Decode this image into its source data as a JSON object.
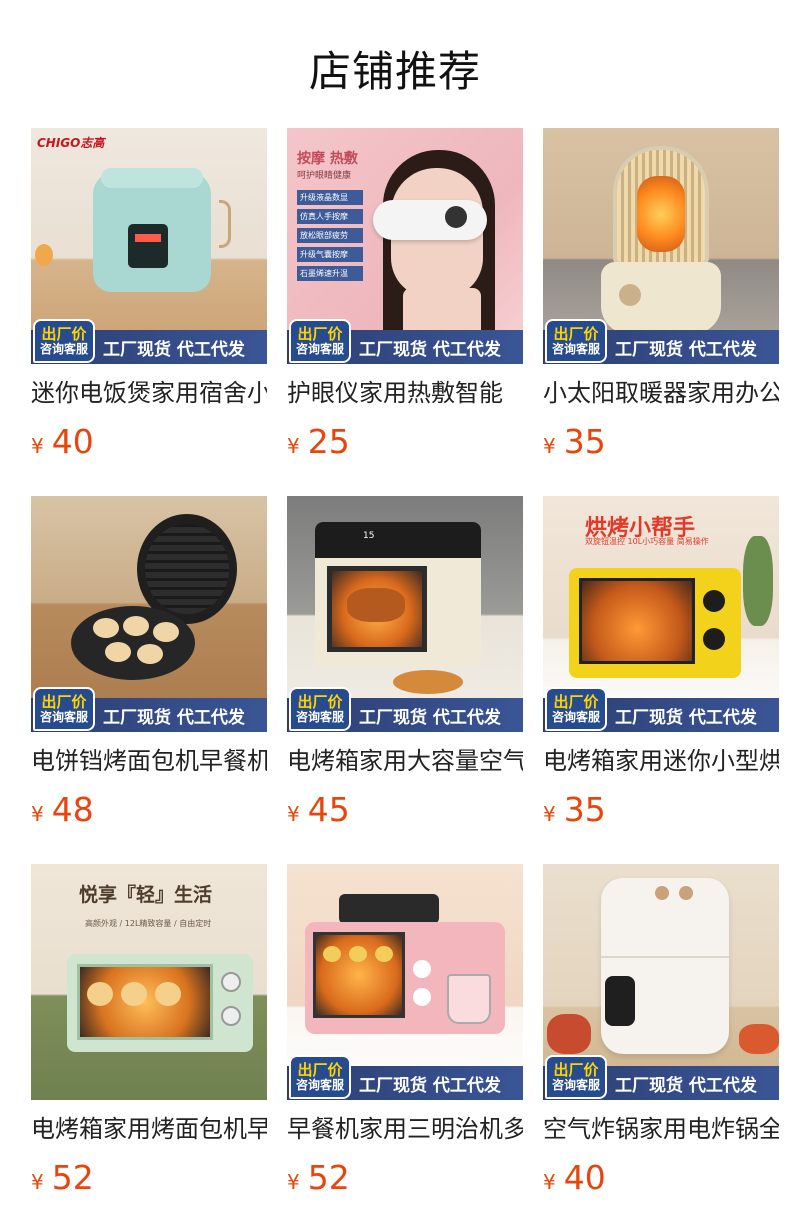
{
  "page": {
    "title": "店铺推荐"
  },
  "badge": {
    "line1": "出厂价",
    "line2": "咨询客服",
    "promo": "工厂现货 代工代发"
  },
  "products": [
    {
      "name": "迷你电饭煲家用宿舍小型",
      "currency": "¥",
      "price": "40",
      "image_text": {
        "brand": "CHIGO志高"
      }
    },
    {
      "name": "护眼仪家用热敷智能",
      "currency": "¥",
      "price": "25",
      "image_text": {
        "title": "按摩 热敷",
        "subtitle": "呵护眼睛健康",
        "features": [
          "升级液晶数显",
          "仿真人手按摩",
          "放松眼部疲劳",
          "升级气囊按摩",
          "石墨烯速升温"
        ]
      }
    },
    {
      "name": "小太阳取暖器家用办公室",
      "currency": "¥",
      "price": "35",
      "image_text": {}
    },
    {
      "name": "电饼铛烤面包机早餐机",
      "currency": "¥",
      "price": "48",
      "image_text": {}
    },
    {
      "name": "电烤箱家用大容量空气炸",
      "currency": "¥",
      "price": "45",
      "image_text": {
        "display": "15"
      }
    },
    {
      "name": "电烤箱家用迷你小型烘焙",
      "currency": "¥",
      "price": "35",
      "image_text": {
        "title": "烘烤小帮手",
        "subtitle": "双旋钮温控 10L小巧容量 简易操作"
      }
    },
    {
      "name": "电烤箱家用烤面包机早餐",
      "currency": "¥",
      "price": "52",
      "image_text": {
        "title": "悦享『轻』生活",
        "subtitle": "高颜外观 / 12L精致容量 / 自由定时"
      }
    },
    {
      "name": "早餐机家用三明治机多功能",
      "currency": "¥",
      "price": "52",
      "image_text": {}
    },
    {
      "name": "空气炸锅家用电炸锅全自动",
      "currency": "¥",
      "price": "40",
      "image_text": {}
    }
  ]
}
